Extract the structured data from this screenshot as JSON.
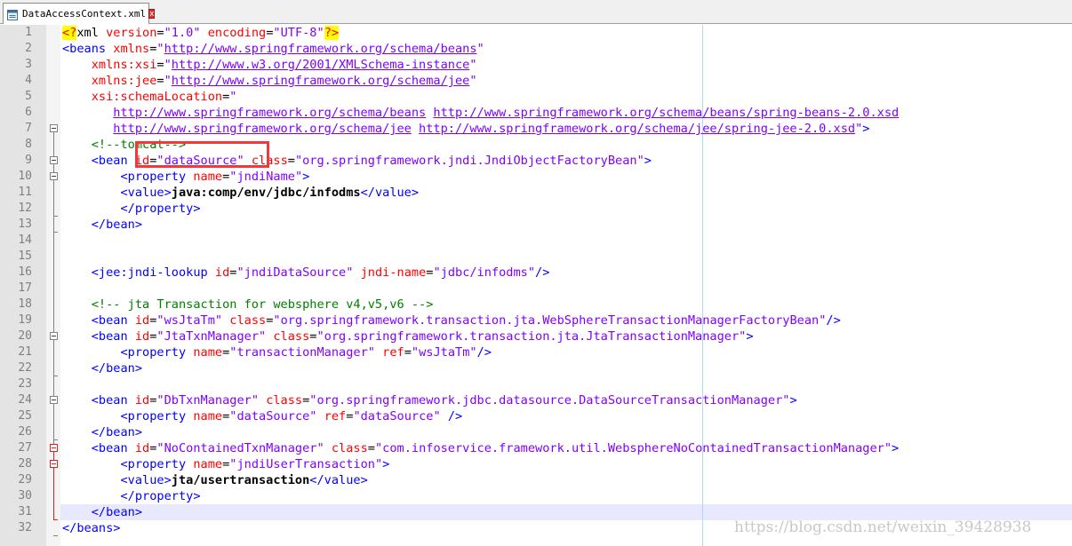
{
  "tab": {
    "title": "DataAccessContext.xml",
    "file_icon": "xml-file-icon",
    "close_icon": "close-icon",
    "close_glyph": "x"
  },
  "line_numbers": [
    "1",
    "2",
    "3",
    "4",
    "5",
    "6",
    "7",
    "8",
    "9",
    "10",
    "11",
    "12",
    "13",
    "14",
    "15",
    "16",
    "17",
    "18",
    "19",
    "20",
    "21",
    "22",
    "23",
    "24",
    "25",
    "26",
    "27",
    "28",
    "29",
    "30",
    "31",
    "32"
  ],
  "code": {
    "l1": {
      "pi_open": "<?",
      "decl": "xml",
      "sp1": " ",
      "a1": "version",
      "eq1": "=",
      "v1": "\"1.0\"",
      "sp2": " ",
      "a2": "encoding",
      "eq2": "=",
      "v2": "\"UTF-8\"",
      "pi_close": "?>"
    },
    "l2": {
      "tag": "<beans",
      "sp": " ",
      "attr": "xmlns",
      "eq": "=",
      "q1": "\"",
      "url": "http://www.springframework.org/schema/beans",
      "q2": "\""
    },
    "l3": {
      "indent": "    ",
      "attr": "xmlns:xsi",
      "eq": "=",
      "q1": "\"",
      "url": "http://www.w3.org/2001/XMLSchema-instance",
      "q2": "\""
    },
    "l4": {
      "indent": "    ",
      "attr": "xmlns:jee",
      "eq": "=",
      "q1": "\"",
      "url": "http://www.springframework.org/schema/jee",
      "q2": "\""
    },
    "l5": {
      "indent": "    ",
      "attr": "xsi:schemaLocation",
      "eq": "=",
      "q1": "\""
    },
    "l6": {
      "indent": "       ",
      "url1": "http://www.springframework.org/schema/beans",
      "sp": " ",
      "url2": "http://www.springframework.org/schema/beans/spring-beans-2.0.xsd"
    },
    "l7": {
      "indent": "       ",
      "url1": "http://www.springframework.org/schema/jee",
      "sp": " ",
      "url2": "http://www.springframework.org/schema/jee/spring-jee-2.0.xsd",
      "q2": "\"",
      "close": ">"
    },
    "l8": {
      "indent": "    ",
      "comment": "<!--tomcat-->"
    },
    "l9": {
      "indent": "    ",
      "tag": "<bean",
      "sp1": " ",
      "a1": "id",
      "eq1": "=",
      "v1": "\"dataSource\"",
      "sp2": " ",
      "a2": "class",
      "eq2": "=",
      "v2": "\"org.springframework.jndi.JndiObjectFactoryBean\"",
      "close": ">"
    },
    "l10": {
      "indent": "        ",
      "tag": "<property",
      "sp": " ",
      "a1": "name",
      "eq1": "=",
      "v1": "\"jndiName\"",
      "close": ">"
    },
    "l11": {
      "indent": "        ",
      "open": "<value>",
      "text": "java:comp/env/jdbc/infodms",
      "close": "</value>"
    },
    "l12": {
      "indent": "        ",
      "tag": "</property>"
    },
    "l13": {
      "indent": "    ",
      "tag": "</bean>"
    },
    "l16": {
      "indent": "    ",
      "tag": "<jee:jndi-lookup",
      "sp1": " ",
      "a1": "id",
      "eq1": "=",
      "v1": "\"jndiDataSource\"",
      "sp2": " ",
      "a2": "jndi-name",
      "eq2": "=",
      "v2": "\"jdbc/infodms\"",
      "close": "/>"
    },
    "l18": {
      "indent": "    ",
      "comment": "<!-- jta Transaction for websphere v4,v5,v6 -->"
    },
    "l19": {
      "indent": "    ",
      "tag": "<bean",
      "sp1": " ",
      "a1": "id",
      "eq1": "=",
      "v1": "\"wsJtaTm\"",
      "sp2": " ",
      "a2": "class",
      "eq2": "=",
      "v2": "\"org.springframework.transaction.jta.WebSphereTransactionManagerFactoryBean\"",
      "close": "/>"
    },
    "l20": {
      "indent": "    ",
      "tag": "<bean",
      "sp1": " ",
      "a1": "id",
      "eq1": "=",
      "v1": "\"JtaTxnManager\"",
      "sp2": " ",
      "a2": "class",
      "eq2": "=",
      "v2": "\"org.springframework.transaction.jta.JtaTransactionManager\"",
      "close": ">"
    },
    "l21": {
      "indent": "        ",
      "tag": "<property",
      "sp1": " ",
      "a1": "name",
      "eq1": "=",
      "v1": "\"transactionManager\"",
      "sp2": " ",
      "a2": "ref",
      "eq2": "=",
      "v2": "\"wsJtaTm\"",
      "close": "/>"
    },
    "l22": {
      "indent": "    ",
      "tag": "</bean>"
    },
    "l24": {
      "indent": "    ",
      "tag": "<bean",
      "sp1": " ",
      "a1": "id",
      "eq1": "=",
      "v1": "\"DbTxnManager\"",
      "sp2": " ",
      "a2": "class",
      "eq2": "=",
      "v2": "\"org.springframework.jdbc.datasource.DataSourceTransactionManager\"",
      "close": ">"
    },
    "l25": {
      "indent": "        ",
      "tag": "<property",
      "sp1": " ",
      "a1": "name",
      "eq1": "=",
      "v1": "\"dataSource\"",
      "sp2": " ",
      "a2": "ref",
      "eq2": "=",
      "v2": "\"dataSource\"",
      "close": " />"
    },
    "l26": {
      "indent": "    ",
      "tag": "</bean>"
    },
    "l27": {
      "indent": "    ",
      "tag": "<bean",
      "sp1": " ",
      "a1": "id",
      "eq1": "=",
      "v1": "\"NoContainedTxnManager\"",
      "sp2": " ",
      "a2": "class",
      "eq2": "=",
      "v2": "\"com.infoservice.framework.util.WebsphereNoContainedTransactionManager\"",
      "close": ">"
    },
    "l28": {
      "indent": "        ",
      "tag": "<property",
      "sp": " ",
      "a1": "name",
      "eq1": "=",
      "v1": "\"jndiUserTransaction\"",
      "close": ">"
    },
    "l29": {
      "indent": "        ",
      "open": "<value>",
      "text": "jta/usertransaction",
      "close": "</value>"
    },
    "l30": {
      "indent": "        ",
      "tag": "</property>"
    },
    "l31": {
      "indent": "    ",
      "tag": "</bean>"
    },
    "l32": {
      "tag": "</beans>"
    }
  },
  "watermark": "https://blog.csdn.net/weixin_39428938",
  "colors": {
    "tag": "#0000ff",
    "attribute": "#ff0000",
    "value": "#8000ff",
    "comment": "#008000",
    "annotation": "#f2383a",
    "caret_line": "#e8e8ff"
  }
}
